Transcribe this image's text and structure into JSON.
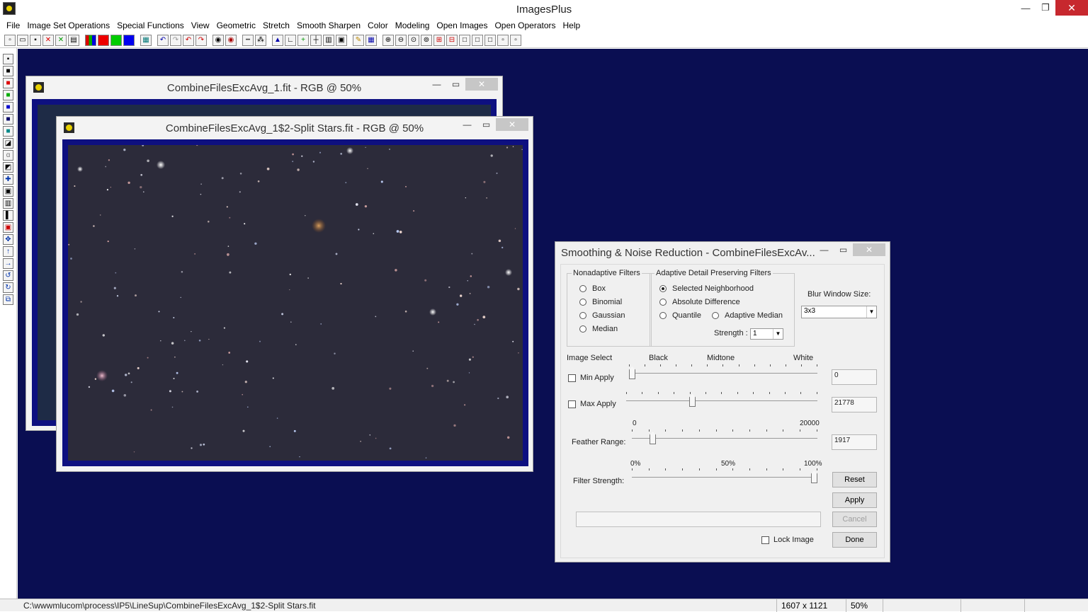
{
  "app": {
    "title": "ImagesPlus"
  },
  "window_buttons": {
    "minimize": "—",
    "restore": "❐",
    "close": "✕"
  },
  "menu": [
    "File",
    "Image Set Operations",
    "Special Functions",
    "View",
    "Geometric",
    "Stretch",
    "Smooth Sharpen",
    "Color",
    "Modeling",
    "Open Images",
    "Open Operators",
    "Help"
  ],
  "image_windows": [
    {
      "title": "CombineFilesExcAvg_1.fit - RGB @ 50%"
    },
    {
      "title": "CombineFilesExcAvg_1$2-Split Stars.fit - RGB @ 50%"
    }
  ],
  "dialog": {
    "title": "Smoothing & Noise Reduction - CombineFilesExcAv...",
    "nonadaptive": {
      "legend": "Nonadaptive Filters",
      "options": [
        "Box",
        "Binomial",
        "Gaussian",
        "Median"
      ]
    },
    "adaptive": {
      "legend": "Adaptive Detail Preserving Filters",
      "options": [
        "Selected Neighborhood",
        "Absolute Difference",
        "Quantile",
        "Adaptive Median"
      ],
      "selected": "Selected Neighborhood",
      "strength_label": "Strength :",
      "strength_value": "1"
    },
    "blur": {
      "label": "Blur Window Size:",
      "value": "3x3"
    },
    "image_select": {
      "label": "Image Select",
      "black": "Black",
      "midtone": "Midtone",
      "white": "White"
    },
    "min_apply": {
      "label": "Min Apply",
      "value": "0",
      "position": 0.0
    },
    "max_apply": {
      "label": "Max Apply",
      "value": "21778",
      "position": 0.34
    },
    "feather": {
      "label": "Feather Range:",
      "min": "0",
      "max": "20000",
      "value": "1917",
      "position": 0.1
    },
    "filter_strength": {
      "label": "Filter Strength:",
      "p0": "0%",
      "p50": "50%",
      "p100": "100%",
      "position": 1.0
    },
    "buttons": {
      "reset": "Reset",
      "apply": "Apply",
      "cancel": "Cancel",
      "done": "Done"
    },
    "lock_image": "Lock Image"
  },
  "status": {
    "path": "C:\\wwwmlucom\\process\\IP5\\LineSup\\CombineFilesExcAvg_1$2-Split Stars.fit",
    "dimensions": "1607 x 1121",
    "zoom": "50%"
  }
}
